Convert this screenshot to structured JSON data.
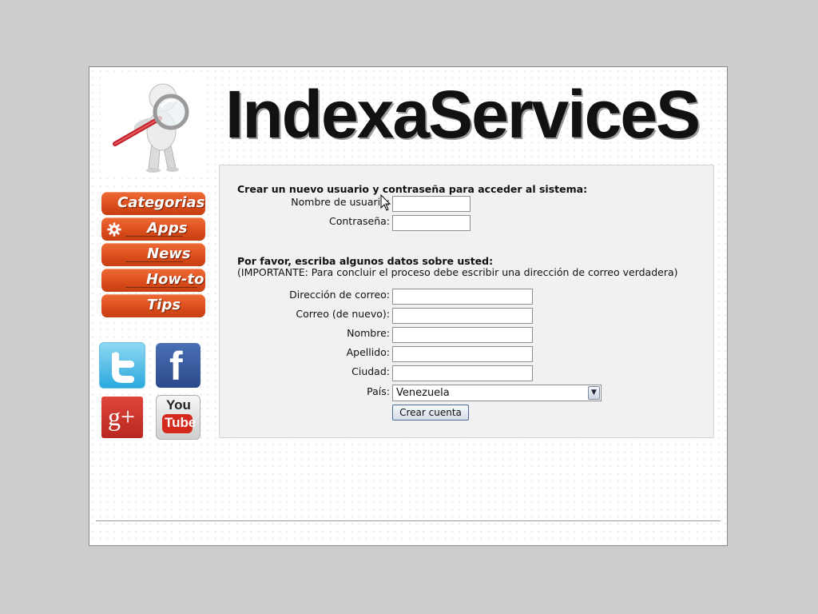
{
  "site": {
    "title": "IndexaServiceS"
  },
  "nav": {
    "items": [
      {
        "label": "Categorias"
      },
      {
        "label": "Apps"
      },
      {
        "label": "News"
      },
      {
        "label": "How-to"
      },
      {
        "label": "Tips"
      }
    ]
  },
  "social": {
    "youtube_top": "You",
    "youtube_bottom": "Tube",
    "googleplus_glyph": "g+",
    "facebook_glyph": "f"
  },
  "form": {
    "account_heading": "Crear un nuevo usuario y contraseña para acceder al sistema:",
    "username_label": "Nombre de usuario:",
    "username_value": "",
    "password_label": "Contraseña:",
    "password_value": "",
    "personal_heading": "Por favor, escriba algunos datos sobre usted:",
    "important_note": "(IMPORTANTE: Para concluir el proceso debe escribir una dirección de correo verdadera)",
    "email_label": "Dirección de correo:",
    "email_value": "",
    "email_again_label": "Correo (de nuevo):",
    "email_again_value": "",
    "first_name_label": "Nombre:",
    "first_name_value": "",
    "last_name_label": "Apellido:",
    "last_name_value": "",
    "city_label": "Ciudad:",
    "city_value": "",
    "country_label": "País:",
    "country_selected": "Venezuela",
    "submit_label": "Crear cuenta"
  },
  "colors": {
    "nav_orange": "#dc4e1d",
    "panel_bg": "#f0f1f0",
    "page_bg": "#cdcdcd"
  }
}
